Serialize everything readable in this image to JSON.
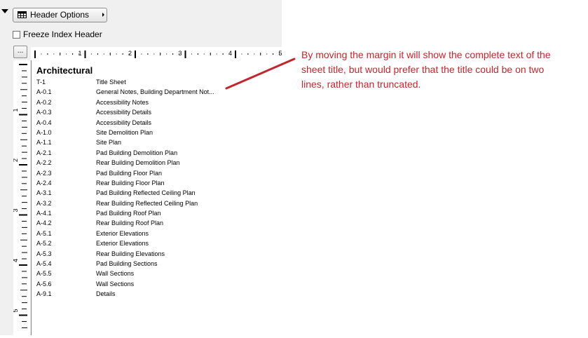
{
  "toolbar": {
    "header_options_label": "Header Options",
    "freeze_label": "Freeze Index Header",
    "freeze_checked": false,
    "ellipsis_label": "..."
  },
  "rulers": {
    "top_labels": [
      "1",
      "2",
      "3",
      "4",
      "5"
    ],
    "left_labels": [
      "1",
      "2",
      "3",
      "4",
      "5"
    ]
  },
  "sheet_index": {
    "section_title": "Architectural",
    "rows": [
      {
        "number": "T-1",
        "name": "Title Sheet"
      },
      {
        "number": "A-0.1",
        "name": "General Notes, Building Department Not..."
      },
      {
        "number": "A-0.2",
        "name": "Accessibility Notes"
      },
      {
        "number": "A-0.3",
        "name": "Accessibility Details"
      },
      {
        "number": "A-0.4",
        "name": "Accessibility Details"
      },
      {
        "number": "A-1.0",
        "name": "Site Demolition Plan"
      },
      {
        "number": "A-1.1",
        "name": "Site Plan"
      },
      {
        "number": "A-2.1",
        "name": "Pad Building Demolition Plan"
      },
      {
        "number": "A-2.2",
        "name": "Rear Building Demolition Plan"
      },
      {
        "number": "A-2.3",
        "name": "Pad Building Floor Plan"
      },
      {
        "number": "A-2.4",
        "name": "Rear Building Floor Plan"
      },
      {
        "number": "A-3.1",
        "name": "Pad Building Reflected Ceiling Plan"
      },
      {
        "number": "A-3.2",
        "name": "Rear Building Reflected Ceiling Plan"
      },
      {
        "number": "A-4.1",
        "name": "Pad Building Roof Plan"
      },
      {
        "number": "A-4.2",
        "name": "Rear Building Roof Plan"
      },
      {
        "number": "A-5.1",
        "name": "Exterior Elevations"
      },
      {
        "number": "A-5.2",
        "name": "Exterior Elevations"
      },
      {
        "number": "A-5.3",
        "name": "Rear Building Elevations"
      },
      {
        "number": "A-5.4",
        "name": "Pad Building Sections"
      },
      {
        "number": "A-5.5",
        "name": "Wall Sections"
      },
      {
        "number": "A-5.6",
        "name": "Wall Sections"
      },
      {
        "number": "A-9.1",
        "name": "Details"
      }
    ]
  },
  "annotation": {
    "text": "By moving the margin it will show the complete text of the sheet title, but would prefer that the title could be on two lines, rather than truncated.",
    "color": "#c0272d"
  }
}
